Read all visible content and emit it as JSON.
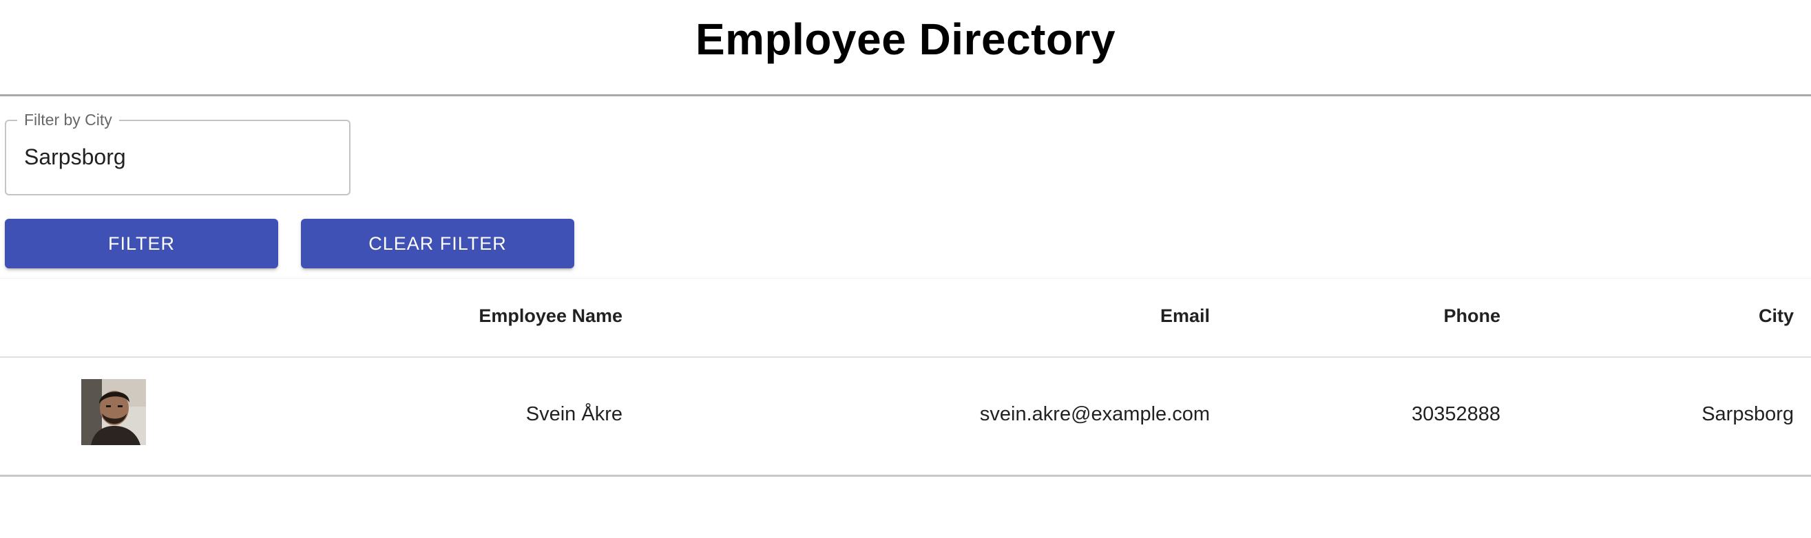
{
  "page": {
    "title": "Employee Directory"
  },
  "filter": {
    "label": "Filter by City",
    "value": "Sarpsborg",
    "filter_button": "FILTER",
    "clear_button": "CLEAR FILTER",
    "accent_color": "#3f51b5"
  },
  "table": {
    "columns": [
      "",
      "Employee Name",
      "Email",
      "Phone",
      "City"
    ],
    "rows": [
      {
        "avatar_icon": "person-photo",
        "name": "Svein Åkre",
        "email": "svein.akre@example.com",
        "phone": "30352888",
        "city": "Sarpsborg"
      }
    ]
  }
}
